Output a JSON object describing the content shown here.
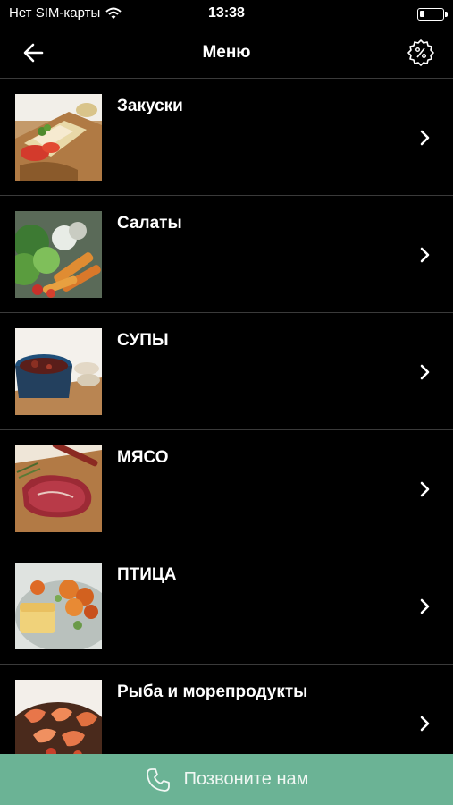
{
  "status_bar": {
    "carrier": "Нет SIM-карты",
    "time": "13:38",
    "battery_level": 0.2
  },
  "nav": {
    "title": "Меню",
    "back_icon": "arrow-left-icon",
    "discount_icon": "percent-badge-icon"
  },
  "menu": {
    "items": [
      {
        "label": "Закуски"
      },
      {
        "label": "Салаты"
      },
      {
        "label": "СУПЫ"
      },
      {
        "label": "МЯСО"
      },
      {
        "label": "ПТИЦА"
      },
      {
        "label": "Рыба и морепродукты"
      }
    ]
  },
  "call_bar": {
    "label": "Позвоните нам",
    "icon": "phone-icon",
    "color": "#6bb395"
  }
}
